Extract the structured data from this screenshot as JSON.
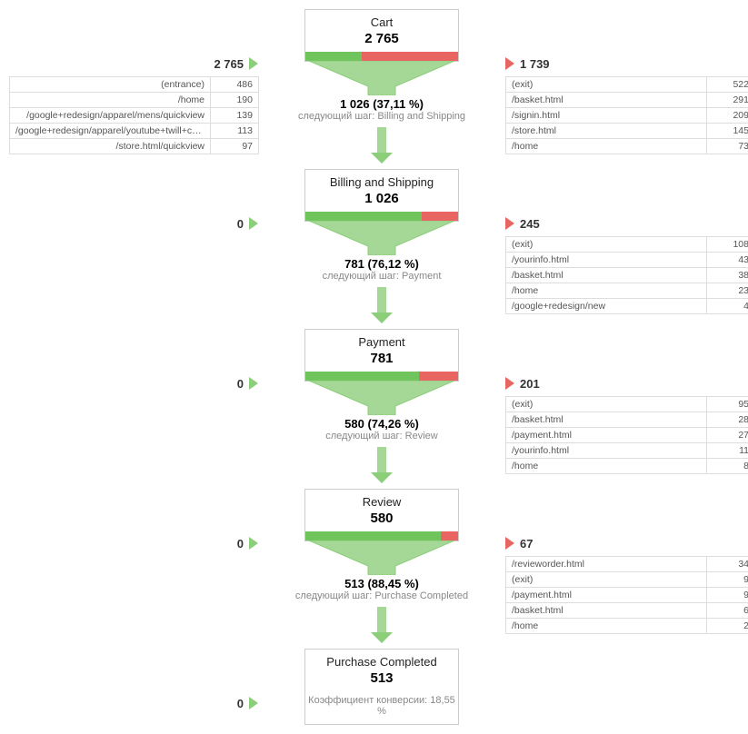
{
  "steps": [
    {
      "title": "Cart",
      "value": "2 765",
      "entries": "2 765",
      "exits": "1 739",
      "green_pct": 37.11,
      "continue_val": "1 026",
      "continue_pct": "(37,11 %)",
      "next_label": "следующий шаг: Billing and Shipping",
      "entry_table": [
        {
          "name": "(entrance)",
          "count": "486"
        },
        {
          "name": "/home",
          "count": "190"
        },
        {
          "name": "/google+redesign/apparel/mens/quickview",
          "count": "139"
        },
        {
          "name": "/google+redesign/apparel/youtube+twill+cap+sandwich+b...",
          "count": "113"
        },
        {
          "name": "/store.html/quickview",
          "count": "97"
        }
      ],
      "exit_table": [
        {
          "name": "(exit)",
          "count": "522"
        },
        {
          "name": "/basket.html",
          "count": "291"
        },
        {
          "name": "/signin.html",
          "count": "209"
        },
        {
          "name": "/store.html",
          "count": "145"
        },
        {
          "name": "/home",
          "count": "73"
        }
      ]
    },
    {
      "title": "Billing and Shipping",
      "value": "1 026",
      "entries": "0",
      "exits": "245",
      "green_pct": 76.12,
      "continue_val": "781",
      "continue_pct": "(76,12 %)",
      "next_label": "следующий шаг: Payment",
      "exit_table": [
        {
          "name": "(exit)",
          "count": "108"
        },
        {
          "name": "/yourinfo.html",
          "count": "43"
        },
        {
          "name": "/basket.html",
          "count": "38"
        },
        {
          "name": "/home",
          "count": "23"
        },
        {
          "name": "/google+redesign/new",
          "count": "4"
        }
      ]
    },
    {
      "title": "Payment",
      "value": "781",
      "entries": "0",
      "exits": "201",
      "green_pct": 74.26,
      "continue_val": "580",
      "continue_pct": "(74,26 %)",
      "next_label": "следующий шаг: Review",
      "exit_table": [
        {
          "name": "(exit)",
          "count": "95"
        },
        {
          "name": "/basket.html",
          "count": "28"
        },
        {
          "name": "/payment.html",
          "count": "27"
        },
        {
          "name": "/yourinfo.html",
          "count": "11"
        },
        {
          "name": "/home",
          "count": "8"
        }
      ]
    },
    {
      "title": "Review",
      "value": "580",
      "entries": "0",
      "exits": "67",
      "green_pct": 88.45,
      "continue_val": "513",
      "continue_pct": "(88,45 %)",
      "next_label": "следующий шаг: Purchase Completed",
      "exit_table": [
        {
          "name": "/revieworder.html",
          "count": "34"
        },
        {
          "name": "(exit)",
          "count": "9"
        },
        {
          "name": "/payment.html",
          "count": "9"
        },
        {
          "name": "/basket.html",
          "count": "6"
        },
        {
          "name": "/home",
          "count": "2"
        }
      ]
    },
    {
      "title": "Purchase Completed",
      "value": "513",
      "entries": "0",
      "final_label": "Коэффициент конверсии: 18,55 %",
      "is_final": true
    }
  ]
}
